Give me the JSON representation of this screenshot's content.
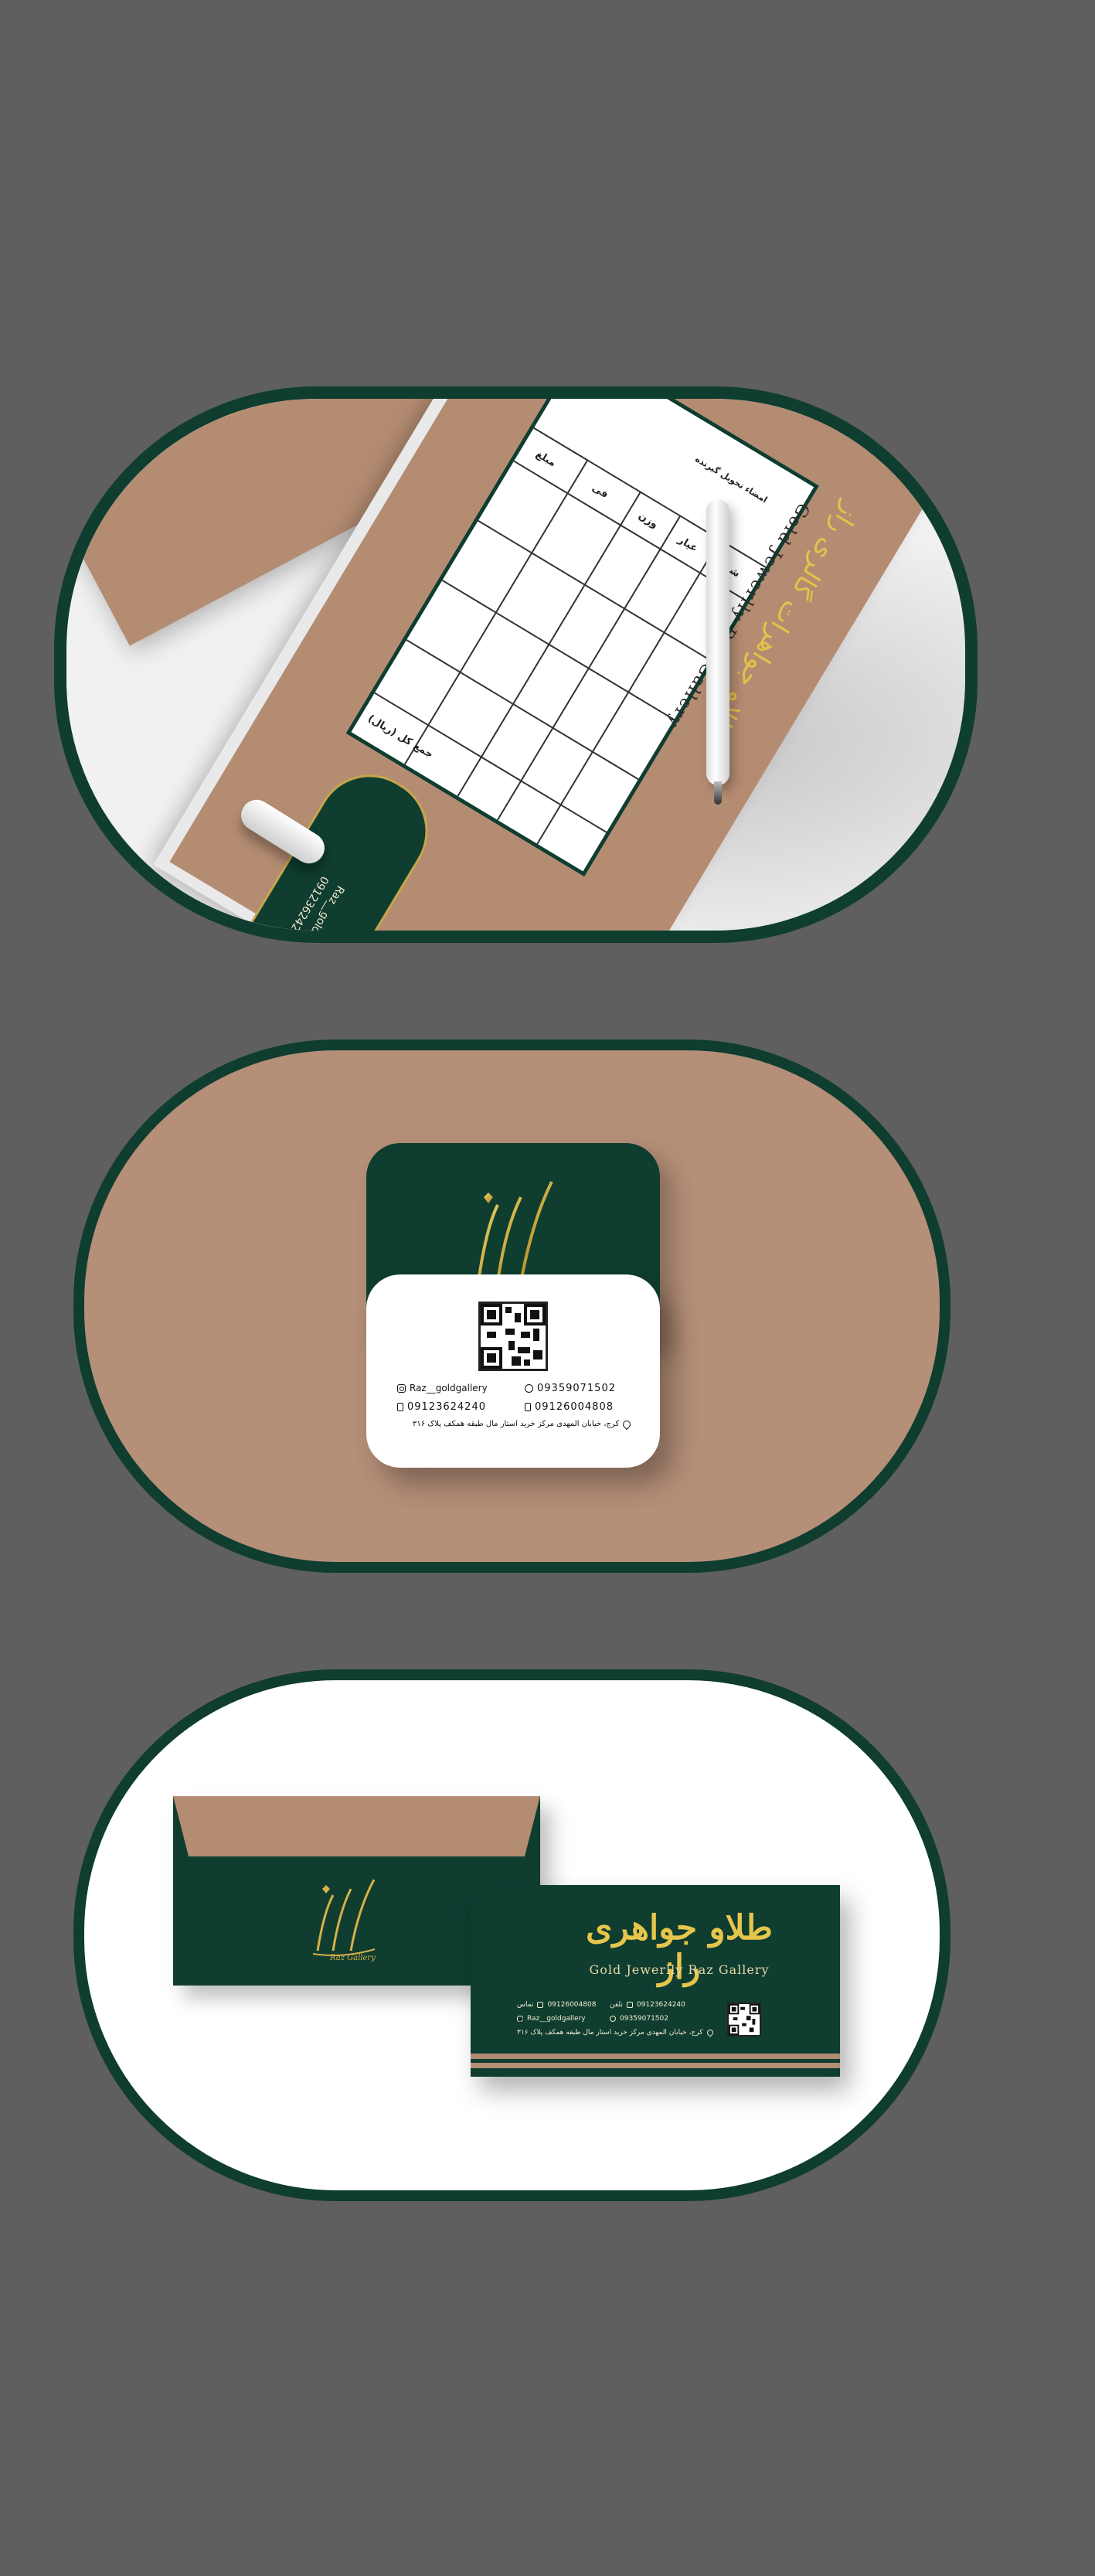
{
  "brand": {
    "name_fa": "طلاو جواهری راز",
    "name_fa_form": "طلاو جواهرات گالری راز",
    "name_en": "Gold Jewerlly Raz Gallery",
    "logo_signature": "Raz Gallery"
  },
  "colors": {
    "background": "#5f5f5f",
    "brand_green": "#0f3d30",
    "brand_tan": "#b48c72",
    "gold": "#e4c24a"
  },
  "invoice_form": {
    "columns": [
      "شرح کالا",
      "عیار",
      "وزن",
      "فی",
      "مبلغ"
    ],
    "footer": "جمع کل (ریال)",
    "signature": "امضاء تحویل گیرنده"
  },
  "contact": {
    "instagram": "Raz__goldgallery",
    "whatsapp": "09359071502",
    "mobile_1": "09123624240",
    "mobile_2": "09126004808",
    "address": "کرج، خیابان المهدی مرکز خرید استار مال طبقه همکف پلاک ۳۱۶"
  },
  "card3_labels": {
    "mobile_tag": "تماس",
    "phone_tag": "تلفن"
  }
}
